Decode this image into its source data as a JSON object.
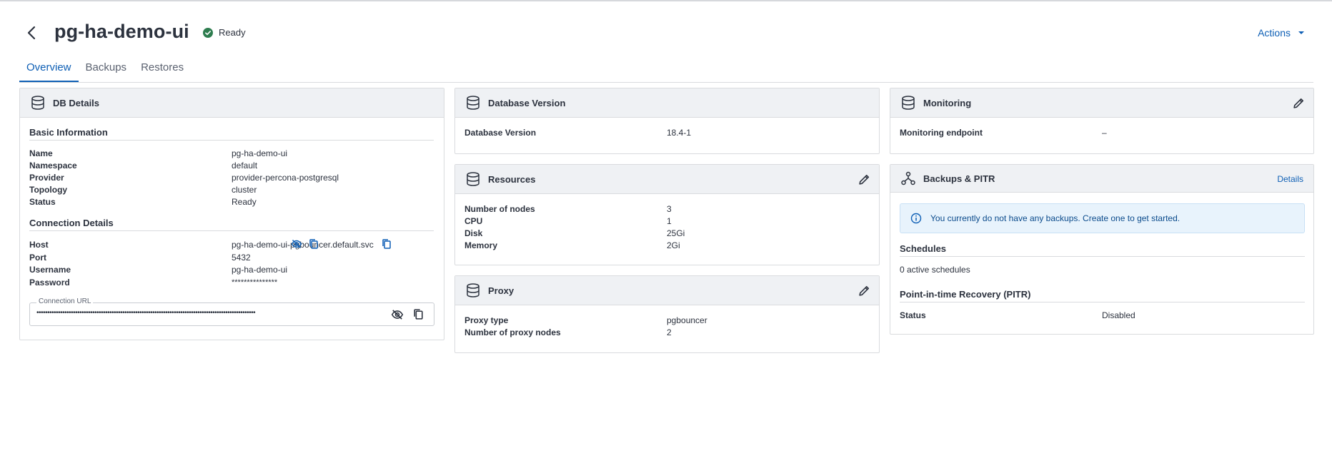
{
  "header": {
    "title": "pg-ha-demo-ui",
    "status": "Ready",
    "actions_label": "Actions"
  },
  "tabs": [
    {
      "label": "Overview",
      "active": true
    },
    {
      "label": "Backups",
      "active": false
    },
    {
      "label": "Restores",
      "active": false
    }
  ],
  "db_details": {
    "title": "DB Details",
    "basic_info": {
      "title": "Basic Information",
      "rows": [
        {
          "label": "Name",
          "value": "pg-ha-demo-ui"
        },
        {
          "label": "Namespace",
          "value": "default"
        },
        {
          "label": "Provider",
          "value": "provider-percona-postgresql"
        },
        {
          "label": "Topology",
          "value": "cluster"
        },
        {
          "label": "Status",
          "value": "Ready"
        }
      ]
    },
    "connection": {
      "title": "Connection Details",
      "host_label": "Host",
      "host_value": "pg-ha-demo-ui-pgbouncer.default.svc",
      "port_label": "Port",
      "port_value": "5432",
      "username_label": "Username",
      "username_value": "pg-ha-demo-ui",
      "password_label": "Password",
      "password_value": "***************",
      "url_label": "Connection URL",
      "url_value": "••••••••••••••••••••••••••••••••••••••••••••••••••••••••••••••••••••••••••••••••••••••••••••••••••••••"
    }
  },
  "database_version": {
    "title": "Database Version",
    "label": "Database Version",
    "value": "18.4-1"
  },
  "resources": {
    "title": "Resources",
    "rows": [
      {
        "label": "Number of nodes",
        "value": "3"
      },
      {
        "label": "CPU",
        "value": "1"
      },
      {
        "label": "Disk",
        "value": "25Gi"
      },
      {
        "label": "Memory",
        "value": "2Gi"
      }
    ]
  },
  "proxy": {
    "title": "Proxy",
    "rows": [
      {
        "label": "Proxy type",
        "value": "pgbouncer"
      },
      {
        "label": "Number of proxy nodes",
        "value": "2"
      }
    ]
  },
  "monitoring": {
    "title": "Monitoring",
    "label": "Monitoring endpoint",
    "value": "–"
  },
  "backups": {
    "title": "Backups & PITR",
    "details_label": "Details",
    "info_message": "You currently do not have any backups. Create one to get started.",
    "schedules_title": "Schedules",
    "schedules_value": "0 active schedules",
    "pitr_title": "Point-in-time Recovery (PITR)",
    "pitr_status_label": "Status",
    "pitr_status_value": "Disabled"
  },
  "colors": {
    "accent": "#0e5fb5",
    "ready_green": "#2e7d4f",
    "header_bg": "#eff1f4",
    "info_bg": "#e8f3fc"
  },
  "icons": [
    "back-arrow-icon",
    "ready-check-icon",
    "caret-down-icon",
    "database-icon",
    "edit-pencil-icon",
    "copy-icon",
    "eye-off-icon",
    "backups-icon",
    "info-icon"
  ]
}
